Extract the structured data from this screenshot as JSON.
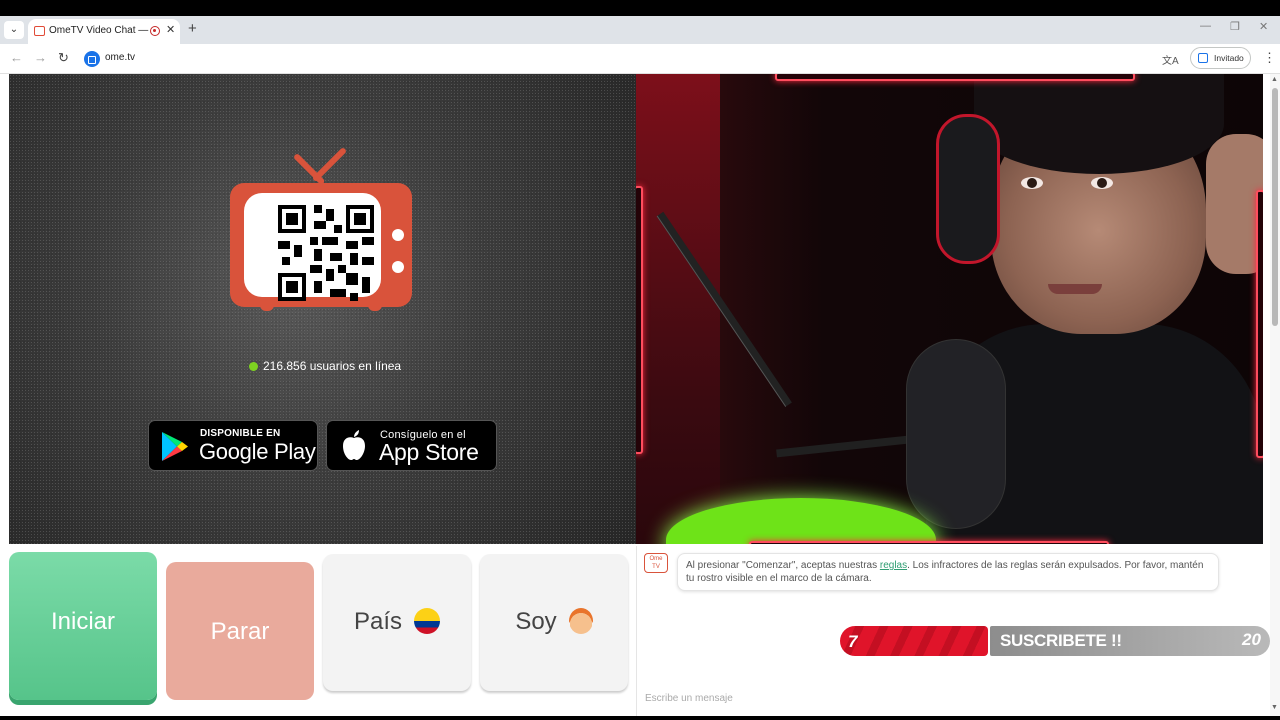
{
  "browser": {
    "tab_title": "OmeTV Video Chat — Ome",
    "tab_close": "✕",
    "new_tab": "+",
    "url": "ome.tv",
    "guest_label": "Invitado",
    "controls": {
      "minimize": "—",
      "restore": "❐",
      "close": "✕"
    },
    "nav": {
      "back": "←",
      "forward": "→",
      "reload": "↻"
    }
  },
  "left_panel": {
    "online_count_text": "216.856 usuarios en línea",
    "google_play": {
      "small": "DISPONIBLE EN",
      "big": "Google Play"
    },
    "app_store": {
      "small": "Consíguelo en el",
      "big": "App Store"
    }
  },
  "controls": {
    "start": "Iniciar",
    "stop": "Parar",
    "country": "País",
    "iam": "Soy"
  },
  "chat": {
    "logo_text": "Ome TV",
    "message_before": "Al presionar \"Comenzar\", aceptas nuestras ",
    "message_link": "reglas",
    "message_after": ". Los infractores de las reglas serán expulsados. Por favor, mantén tu rostro visible en el marco de la cámara.",
    "input_placeholder": "Escribe un mensaje"
  },
  "overlay": {
    "left_number": "7",
    "subscribe_text": "SUSCRIBETE !!",
    "right_number": "20"
  },
  "colors": {
    "start": "#56c48a",
    "stop": "#e9aa9c",
    "brand": "#d9533b",
    "online_dot": "#7ed321",
    "frame_glow": "#ff2a40"
  }
}
